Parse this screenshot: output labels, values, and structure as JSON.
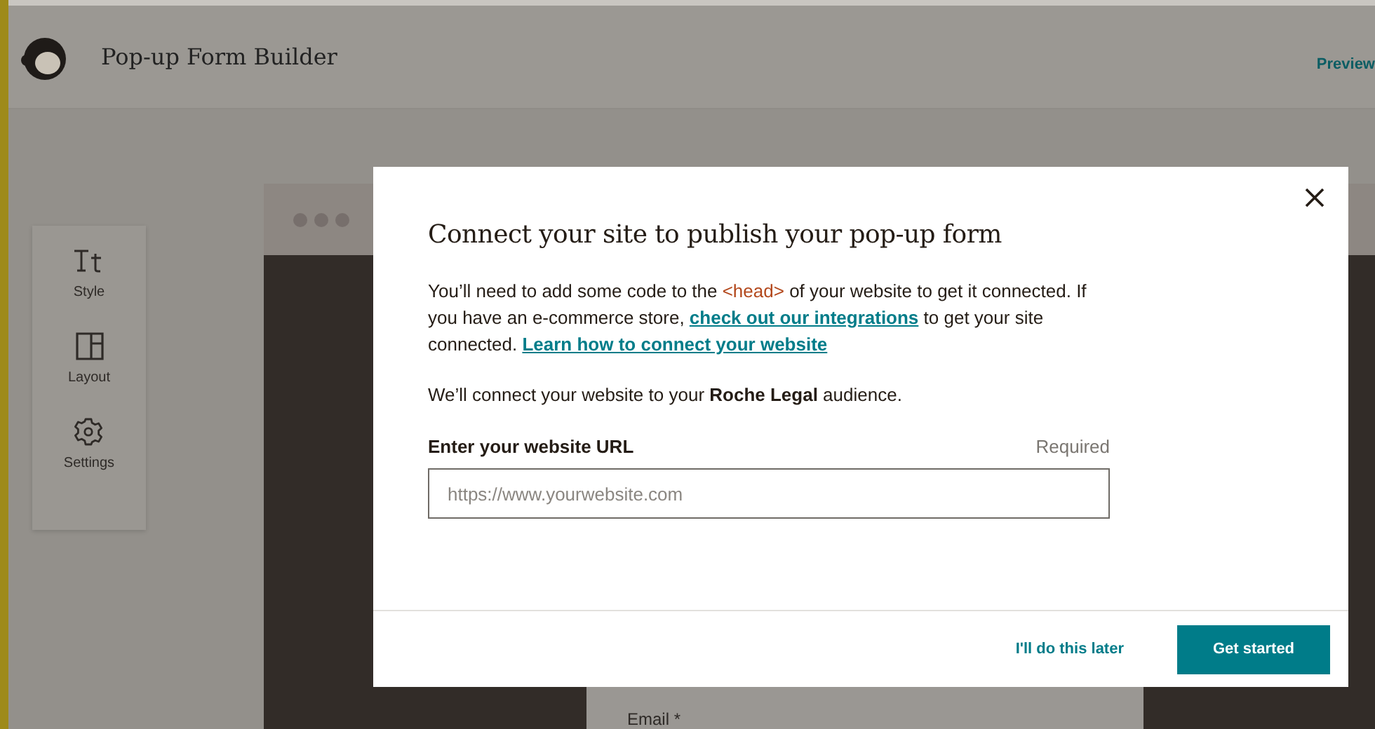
{
  "app": {
    "title": "Pop-up Form Builder",
    "preview_link": "Preview"
  },
  "sidebar": {
    "items": [
      {
        "kind": "style",
        "label": "Style"
      },
      {
        "kind": "layout",
        "label": "Layout"
      },
      {
        "kind": "settings",
        "label": "Settings"
      }
    ]
  },
  "canvas": {
    "field_label": "Email *"
  },
  "modal": {
    "title": "Connect your site to publish your pop-up form",
    "intro": [
      {
        "kind": "text",
        "text": "You’ll need to add some code to the "
      },
      {
        "kind": "code",
        "text": "<head>"
      },
      {
        "kind": "text",
        "text": " of your website to get it connected. If you have an e-commerce store, "
      },
      {
        "kind": "link",
        "text": "check out our integrations"
      },
      {
        "kind": "text",
        "text": " to get your site connected. "
      },
      {
        "kind": "link",
        "text": "Learn how to connect your website"
      }
    ],
    "audience_note": "We’ll connect your website to your **Roche Legal** audience.",
    "url_field": {
      "label": "Enter your website URL",
      "hint": "Required",
      "placeholder": "https://www.yourwebsite.com"
    },
    "secondary_button": "I'll do this later",
    "primary_button": "Get started"
  }
}
